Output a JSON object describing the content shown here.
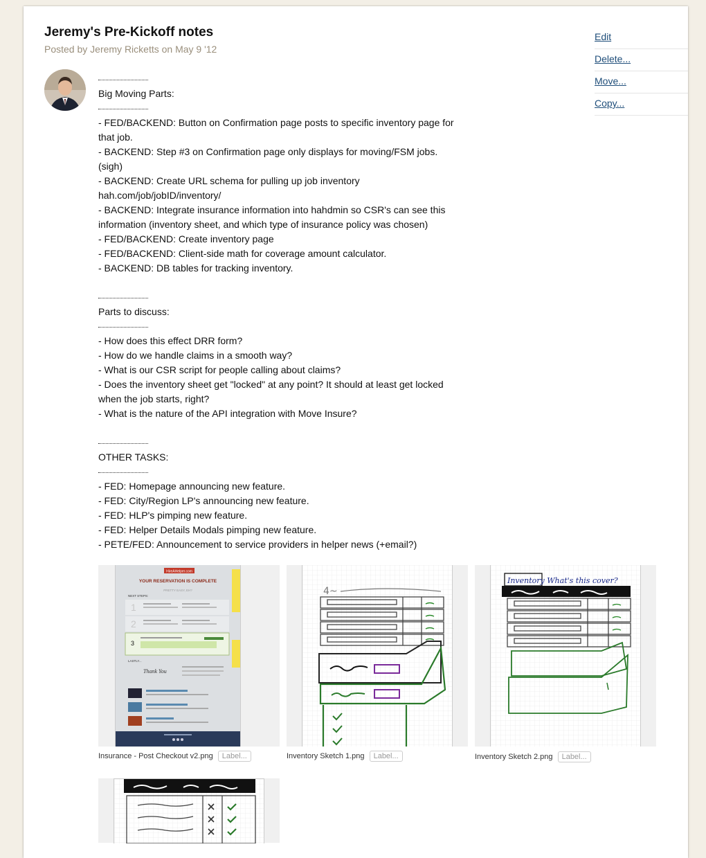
{
  "post": {
    "title": "Jeremy's Pre-Kickoff notes",
    "byline": "Posted by Jeremy Ricketts on May 9 '12"
  },
  "actions": [
    "Edit",
    "Delete...",
    "Move...",
    "Copy..."
  ],
  "notes": {
    "section1_title": "Big Moving Parts:",
    "section1_items": [
      "- FED/BACKEND: Button on Confirmation page posts to specific inventory page for",
      "that job.",
      "- BACKEND: Step #3 on Confirmation page only displays for moving/FSM jobs.",
      "(sigh)",
      "- BACKEND: Create URL schema for pulling up job inventory",
      "hah.com/job/jobID/inventory/",
      "- BACKEND: Integrate insurance information into hahdmin so CSR's can see this",
      "information (inventory sheet, and which type of insurance policy was chosen)",
      "- FED/BACKEND: Create inventory page",
      "- FED/BACKEND: Client-side math for coverage amount calculator.",
      "- BACKEND: DB tables for tracking inventory."
    ],
    "section2_title": "Parts to discuss:",
    "section2_items": [
      "- How does this effect DRR form?",
      "- How do we handle claims in a smooth way?",
      "- What is our CSR script for people calling about claims?",
      "- Does the inventory sheet get \"locked\" at any point? It should at least get locked",
      "when the job starts, right?",
      "- What is the nature of the API integration with Move Insure?"
    ],
    "section3_title": "OTHER TASKS:",
    "section3_items": [
      "- FED: Homepage announcing new feature.",
      "- FED: City/Region LP's announcing new feature.",
      "- FED: HLP's pimping new feature.",
      "- FED: Helper Details Modals pimping new feature.",
      "- PETE/FED: Announcement to service providers in helper news (+email?)"
    ]
  },
  "attachments": [
    {
      "filename": "Insurance - Post Checkout v2.png",
      "label_button": "Label..."
    },
    {
      "filename": "Inventory Sketch 1.png",
      "label_button": "Label..."
    },
    {
      "filename": "Inventory Sketch 2.png",
      "label_button": "Label..."
    }
  ],
  "mockup": {
    "brand": "HireAHelper.com",
    "headline": "YOUR RESERVATION IS COMPLETE",
    "subline": "PRETTY EASY, EH?",
    "next_steps": "NEXT STEPS:",
    "step_number": "3",
    "thank_you": "Thank You",
    "lastly": "LASTLY..."
  },
  "sketches": {
    "sketch1_note": "4~",
    "sketch2_note": "Inventory  What's this cover?"
  }
}
